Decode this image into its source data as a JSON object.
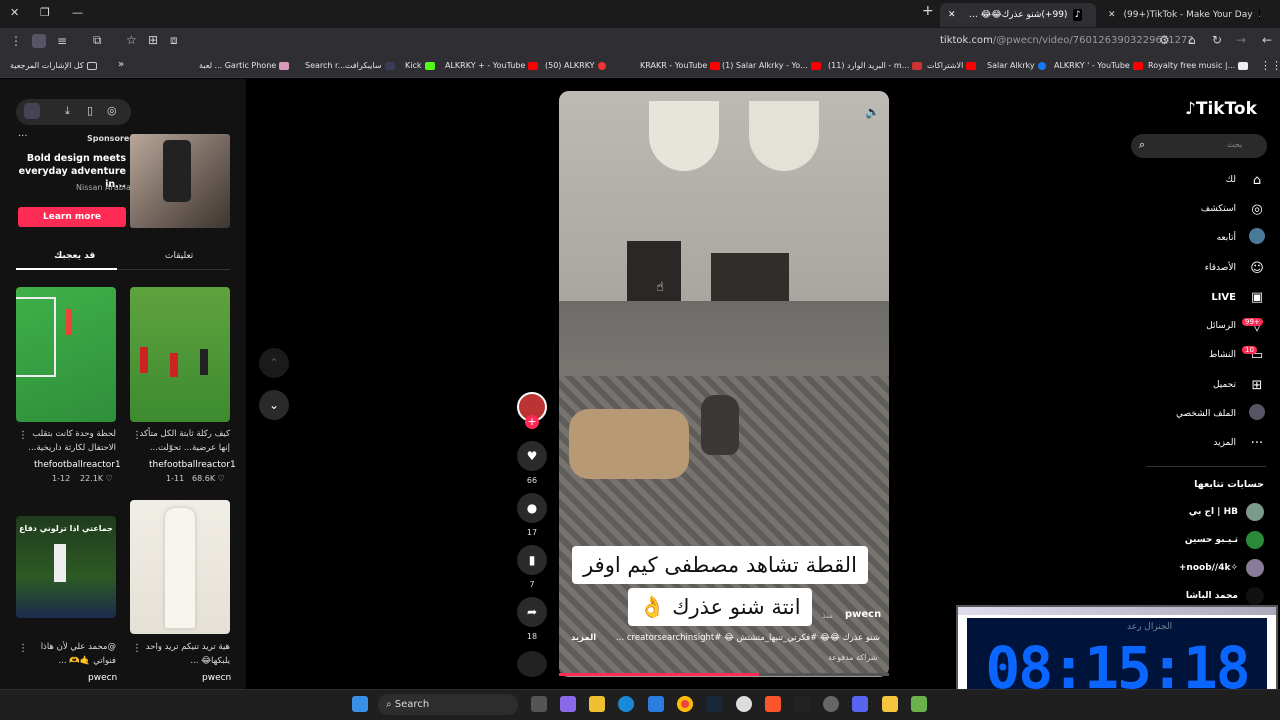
{
  "browser": {
    "tabs": [
      {
        "label": "(99+)TikTok - Make Your Day",
        "active": false
      },
      {
        "label": "(99+)شنو عذرك😂😂 #فكرتي_تنب...",
        "active": true
      }
    ],
    "new_tab": "+",
    "url_host": "tiktok.com",
    "url_path": "/@pwecn/video/7601263903229611272",
    "bookmarks": [
      "Royalty free music |...",
      "ALKRKY ' - YouTube",
      "Salar Alkrky",
      "الاشتراكات",
      "البريد الوارد (11) - m...",
      "(1) Salar Alkrky - Yo...",
      "KRAKR - YouTube",
      "(50) ALKRKY",
      "ALKRKY + - YouTube",
      "Kick",
      "سايبكرافت",
      "Search r...",
      "لعبة ... Gartic Phone",
      "كل الإشارات المرجعية"
    ]
  },
  "left_panel": {
    "ad_label": "Sponsored",
    "ad_title": "Bold design meets everyday adventure in...",
    "ad_brand": "Nissan Arabia",
    "ad_button": "Learn more",
    "tab_comments": "تعليقات",
    "tab_you_may_like": "قد يعجبك",
    "videos": [
      {
        "caption": "لحظة وحدة كانت بتقلب الاحتفال لكارثة داريخية...",
        "user": "thefootballreactor1",
        "date": "1-12",
        "likes": "22.1K"
      },
      {
        "caption": "كيف ركلة ثابتة الكل متأكد إنها عرضية... تحوّلت...",
        "user": "thefootballreactor1",
        "date": "1-11",
        "likes": "68.6K"
      },
      {
        "caption": "@محمد علي لأن هاذا فنواتي 🤙🫶 ...",
        "user": "pwecn",
        "date": "",
        "likes": "",
        "overlay": "جماعتي اذا تزلوني دفاع"
      },
      {
        "caption": "هية تريد تنيكم تريد واحد يلبكها😂 ...",
        "user": "pwecn",
        "date": "",
        "likes": ""
      }
    ]
  },
  "video": {
    "overlay_line1": "القطة تشاهد مصطفى كيم اوفر",
    "overlay_line2": "انتة شنو عذرك 👌",
    "author": "pwecn",
    "author_time": "منذ",
    "caption": "شنو عذرك 😂😂 #فكرتي_تنبها_متشتش 😂 #creatorsearchinsight ...",
    "more": "المزيد",
    "paid": "شراكة مدفوعة",
    "likes": "66",
    "comments": "17",
    "saves": "7",
    "shares": "18"
  },
  "right_nav": {
    "logo": "TikTok",
    "search_placeholder": "بحث",
    "items": [
      {
        "label": "لك",
        "icon": "home-icon"
      },
      {
        "label": "استكشف",
        "icon": "explore-icon"
      },
      {
        "label": "أتابعه",
        "icon": "following-icon"
      },
      {
        "label": "الأصدقاء",
        "icon": "friends-icon"
      },
      {
        "label": "LIVE",
        "icon": "live-icon"
      },
      {
        "label": "الرسائل",
        "icon": "messages-icon",
        "badge": "99+"
      },
      {
        "label": "النشاط",
        "icon": "activity-icon",
        "badge": "10"
      },
      {
        "label": "تحميل",
        "icon": "upload-icon"
      },
      {
        "label": "الملف الشخصي",
        "icon": "profile-icon"
      },
      {
        "label": "المزيد",
        "icon": "more-icon"
      }
    ],
    "following_title": "حسابات تتابعها",
    "following": [
      "اج بي | HB",
      "تـيـبو حسين",
      "+noob//4k✧",
      "محمد الباشا",
      "الجنرال رعد"
    ]
  },
  "clock": {
    "time": "08:15:18"
  },
  "taskbar": {
    "search_label": "Search"
  }
}
